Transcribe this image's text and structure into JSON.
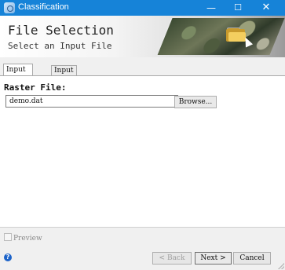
{
  "window": {
    "title": "Classification",
    "controls": {
      "minimize": "—",
      "maximize": "☐",
      "close": "✕"
    },
    "accent": "#1683d8"
  },
  "header": {
    "title": "File Selection",
    "subtitle": "Select an Input File",
    "image_icon": "folder-icon"
  },
  "tabs": [
    {
      "label": "Input Raster",
      "active": true
    },
    {
      "label": "Input Mask",
      "active": false
    }
  ],
  "raster": {
    "label": "Raster File:",
    "value": "demo.dat",
    "browse_label": "Browse..."
  },
  "footer": {
    "preview_label": "Preview",
    "preview_checked": false,
    "help_icon": "help-icon",
    "help_glyph": "?",
    "back_label": "< Back",
    "next_label": "Next >",
    "cancel_label": "Cancel"
  }
}
